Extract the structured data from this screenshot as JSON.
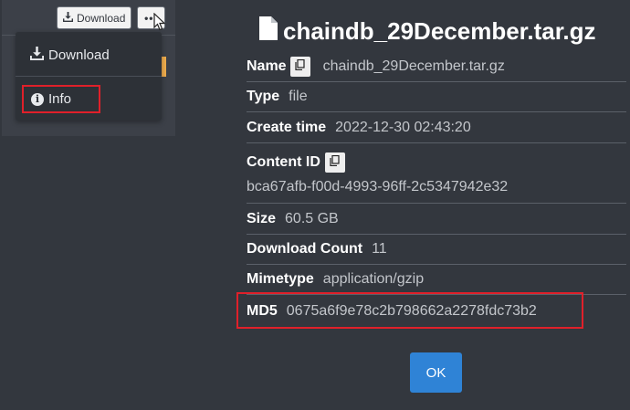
{
  "toolbar": {
    "download_label": "Download",
    "more_label": "•••"
  },
  "dropdown": {
    "download_label": "Download",
    "info_label": "Info"
  },
  "file": {
    "title": "chaindb_29December.tar.gz"
  },
  "details": {
    "name_label": "Name",
    "name_value": "chaindb_29December.tar.gz",
    "type_label": "Type",
    "type_value": "file",
    "create_time_label": "Create time",
    "create_time_value": "2022-12-30 02:43:20",
    "content_id_label": "Content ID",
    "content_id_value": "bca67afb-f00d-4993-96ff-2c5347942e32",
    "size_label": "Size",
    "size_value": "60.5 GB",
    "download_count_label": "Download Count",
    "download_count_value": "11",
    "mimetype_label": "Mimetype",
    "mimetype_value": "application/gzip",
    "md5_label": "MD5",
    "md5_value": "0675a6f9e78c2b798662a2278fdc73b2"
  },
  "dialog": {
    "ok_label": "OK"
  },
  "colors": {
    "background": "#33373e",
    "highlight": "#e0202a",
    "primary": "#2f83d6"
  },
  "icons": {
    "download": "download-icon",
    "info": "info-icon",
    "file": "file-icon",
    "copy": "copy-icon",
    "cursor": "mouse-cursor-icon"
  }
}
